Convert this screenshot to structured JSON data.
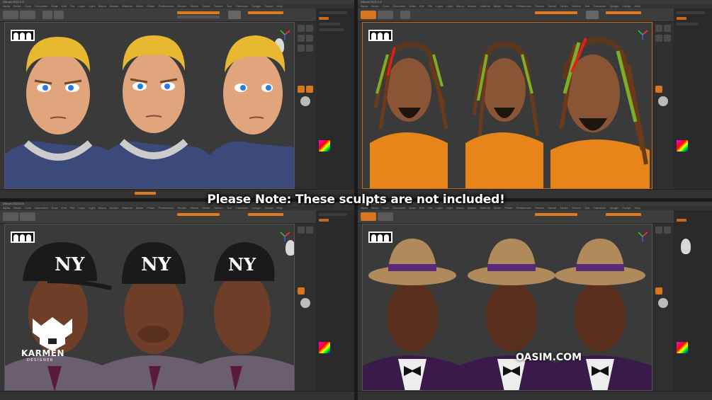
{
  "panes": [
    {
      "title": "ZBrush 2022.0.8",
      "menu": [
        "Alpha",
        "Brush",
        "Color",
        "Document",
        "Draw",
        "Edit",
        "File",
        "Layer",
        "Light",
        "Macro",
        "Marker",
        "Material",
        "Movie",
        "Picker",
        "Preferences",
        "Render",
        "Stencil",
        "Stroke",
        "Texture",
        "Tool",
        "Transform",
        "Zplugin",
        "Zscript",
        "Help"
      ]
    },
    {
      "title": "ZBrush 2022.0.8",
      "menu": [
        "Alpha",
        "Brush",
        "Color",
        "Document",
        "Draw",
        "Edit",
        "File",
        "Layer",
        "Light",
        "Macro",
        "Marker",
        "Material",
        "Movie",
        "Picker",
        "Preferences",
        "Render",
        "Stencil",
        "Stroke",
        "Texture",
        "Tool",
        "Transform",
        "Zplugin",
        "Zscript",
        "Help"
      ]
    },
    {
      "title": "ZBrush 2022.0.8",
      "menu": [
        "Alpha",
        "Brush",
        "Color",
        "Document",
        "Draw",
        "Edit",
        "File",
        "Layer",
        "Light",
        "Macro",
        "Marker",
        "Material",
        "Movie",
        "Picker",
        "Preferences",
        "Render",
        "Stencil",
        "Stroke",
        "Texture",
        "Tool",
        "Transform",
        "Zplugin",
        "Zscript",
        "Help"
      ]
    },
    {
      "title": "ZBrush 2022.0.8",
      "menu": [
        "Alpha",
        "Brush",
        "Color",
        "Document",
        "Draw",
        "Edit",
        "File",
        "Layer",
        "Light",
        "Macro",
        "Marker",
        "Material",
        "Movie",
        "Picker",
        "Preferences",
        "Render",
        "Stencil",
        "Stroke",
        "Texture",
        "Tool",
        "Transform",
        "Zplugin",
        "Zscript",
        "Help"
      ]
    }
  ],
  "overlay": {
    "note": "Please Note: These sculpts are not included!",
    "logo_name": "KARMEN",
    "logo_sub": "DESIGNER",
    "watermark": "OASIM.COM"
  },
  "icons": {
    "people": "people-group-icon",
    "axis": "axis-gizmo-icon",
    "head": "head-preview-icon",
    "color": "color-picker-icon"
  },
  "colors": {
    "accent": "#e07a1f",
    "panel": "#2b2b2b",
    "viewport": "#3a3a3a"
  }
}
